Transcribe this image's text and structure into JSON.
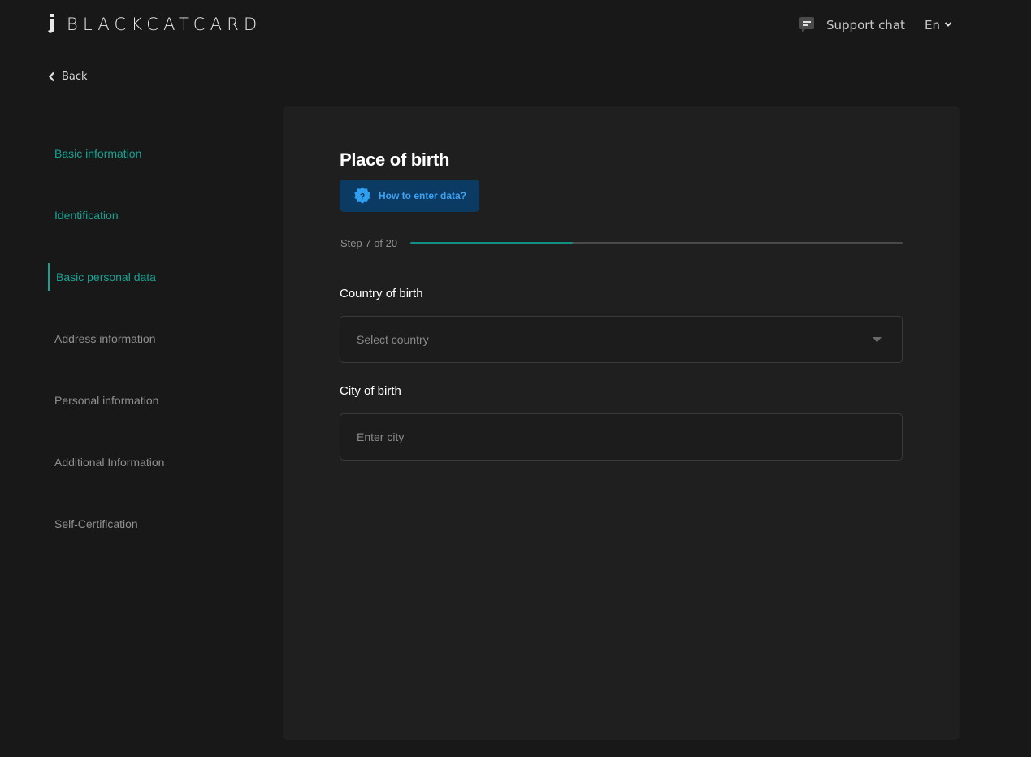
{
  "header": {
    "logo_text": "BLACKCATCARD",
    "support_label": "Support chat",
    "support_icon": "chat-bubble-icon",
    "language": "En"
  },
  "back": {
    "label": "Back"
  },
  "sidebar": {
    "items": [
      {
        "label": "Basic information",
        "state": "done"
      },
      {
        "label": "Identification",
        "state": "done"
      },
      {
        "label": "Basic personal data",
        "state": "active"
      },
      {
        "label": "Address information",
        "state": "pending"
      },
      {
        "label": "Personal information",
        "state": "pending"
      },
      {
        "label": "Additional Information",
        "state": "pending"
      },
      {
        "label": "Self-Certification",
        "state": "pending"
      }
    ]
  },
  "main": {
    "title": "Place of birth",
    "help_button": {
      "label": "How to enter data?",
      "icon": "question-badge-icon"
    },
    "step": {
      "label": "Step 7 of 20",
      "current": 7,
      "total": 20,
      "progress_fraction": 0.33
    },
    "country": {
      "label": "Country of birth",
      "placeholder": "Select country",
      "value": ""
    },
    "city": {
      "label": "City of birth",
      "placeholder": "Enter city",
      "value": ""
    }
  },
  "colors": {
    "background": "#181818",
    "card": "#1f1f1f",
    "accent": "#16a394",
    "help_button_bg": "#0b3a62",
    "help_button_text": "#3ea2f2",
    "muted_text": "#8f8f8f"
  }
}
